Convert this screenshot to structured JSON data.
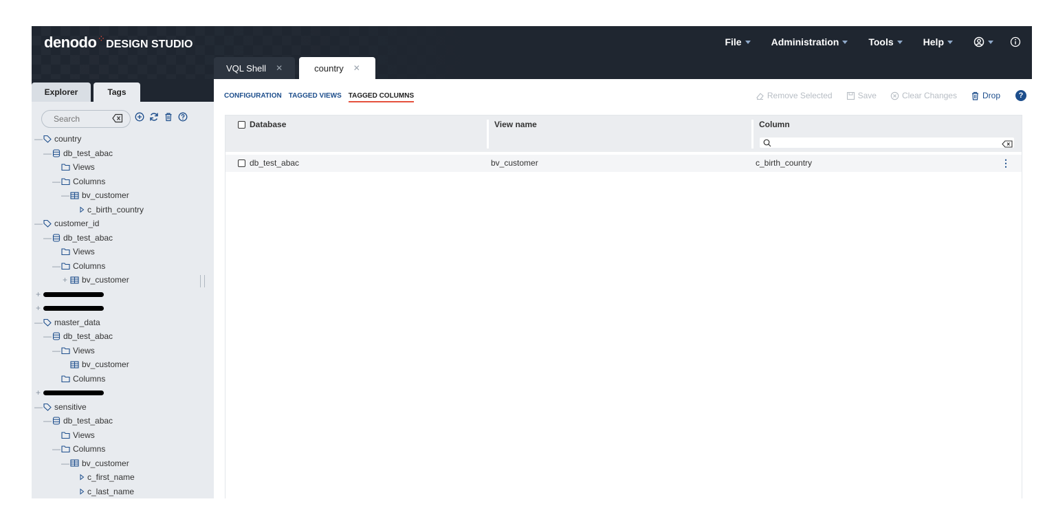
{
  "app": {
    "brand": "denodo",
    "product": "DESIGN STUDIO"
  },
  "menu": {
    "file": "File",
    "administration": "Administration",
    "tools": "Tools",
    "help": "Help"
  },
  "tabs": [
    {
      "label": "VQL Shell"
    },
    {
      "label": "country"
    }
  ],
  "sidebar": {
    "tabs": [
      "Explorer",
      "Tags"
    ],
    "search_placeholder": "Search",
    "tree": [
      {
        "indent": 0,
        "toggle": "—",
        "icon": "tag-icon",
        "label": "country"
      },
      {
        "indent": 1,
        "toggle": "—",
        "icon": "database-icon",
        "label": "db_test_abac"
      },
      {
        "indent": 2,
        "toggle": "",
        "icon": "folder-icon",
        "label": "Views"
      },
      {
        "indent": 2,
        "toggle": "—",
        "icon": "folder-icon",
        "label": "Columns"
      },
      {
        "indent": 3,
        "toggle": "—",
        "icon": "view-icon",
        "label": "bv_customer"
      },
      {
        "indent": 4,
        "toggle": "",
        "icon": "column-icon",
        "label": "c_birth_country"
      },
      {
        "indent": 0,
        "toggle": "—",
        "icon": "tag-icon",
        "label": "customer_id"
      },
      {
        "indent": 1,
        "toggle": "—",
        "icon": "database-icon",
        "label": "db_test_abac"
      },
      {
        "indent": 2,
        "toggle": "",
        "icon": "folder-icon",
        "label": "Views"
      },
      {
        "indent": 2,
        "toggle": "—",
        "icon": "folder-icon",
        "label": "Columns"
      },
      {
        "indent": 3,
        "toggle": "+",
        "icon": "view-icon",
        "label": "bv_customer"
      },
      {
        "indent": 0,
        "toggle": "+",
        "icon": "",
        "label": "",
        "redacted": true
      },
      {
        "indent": 0,
        "toggle": "+",
        "icon": "",
        "label": "",
        "redacted": true
      },
      {
        "indent": 0,
        "toggle": "—",
        "icon": "tag-icon",
        "label": "master_data"
      },
      {
        "indent": 1,
        "toggle": "—",
        "icon": "database-icon",
        "label": "db_test_abac"
      },
      {
        "indent": 2,
        "toggle": "—",
        "icon": "folder-icon",
        "label": "Views"
      },
      {
        "indent": 3,
        "toggle": "",
        "icon": "view-icon",
        "label": "bv_customer"
      },
      {
        "indent": 2,
        "toggle": "",
        "icon": "folder-icon",
        "label": "Columns"
      },
      {
        "indent": 0,
        "toggle": "+",
        "icon": "",
        "label": "",
        "redacted": true
      },
      {
        "indent": 0,
        "toggle": "—",
        "icon": "tag-icon",
        "label": "sensitive"
      },
      {
        "indent": 1,
        "toggle": "—",
        "icon": "database-icon",
        "label": "db_test_abac"
      },
      {
        "indent": 2,
        "toggle": "",
        "icon": "folder-icon",
        "label": "Views"
      },
      {
        "indent": 2,
        "toggle": "—",
        "icon": "folder-icon",
        "label": "Columns"
      },
      {
        "indent": 3,
        "toggle": "—",
        "icon": "view-icon",
        "label": "bv_customer"
      },
      {
        "indent": 4,
        "toggle": "",
        "icon": "column-icon",
        "label": "c_first_name"
      },
      {
        "indent": 4,
        "toggle": "",
        "icon": "column-icon",
        "label": "c_last_name"
      }
    ]
  },
  "subtabs": {
    "configuration": "CONFIGURATION",
    "tagged_views": "TAGGED VIEWS",
    "tagged_columns": "TAGGED COLUMNS"
  },
  "actions": {
    "remove_selected": "Remove Selected",
    "save": "Save",
    "clear_changes": "Clear Changes",
    "drop": "Drop",
    "help": "?"
  },
  "grid": {
    "headers": {
      "database": "Database",
      "view_name": "View name",
      "column": "Column"
    },
    "rows": [
      {
        "database": "db_test_abac",
        "view_name": "bv_customer",
        "column": "c_birth_country"
      }
    ]
  },
  "colors": {
    "topbar": "#1f2630",
    "accent": "#e5503c",
    "link": "#1d4e8c"
  }
}
